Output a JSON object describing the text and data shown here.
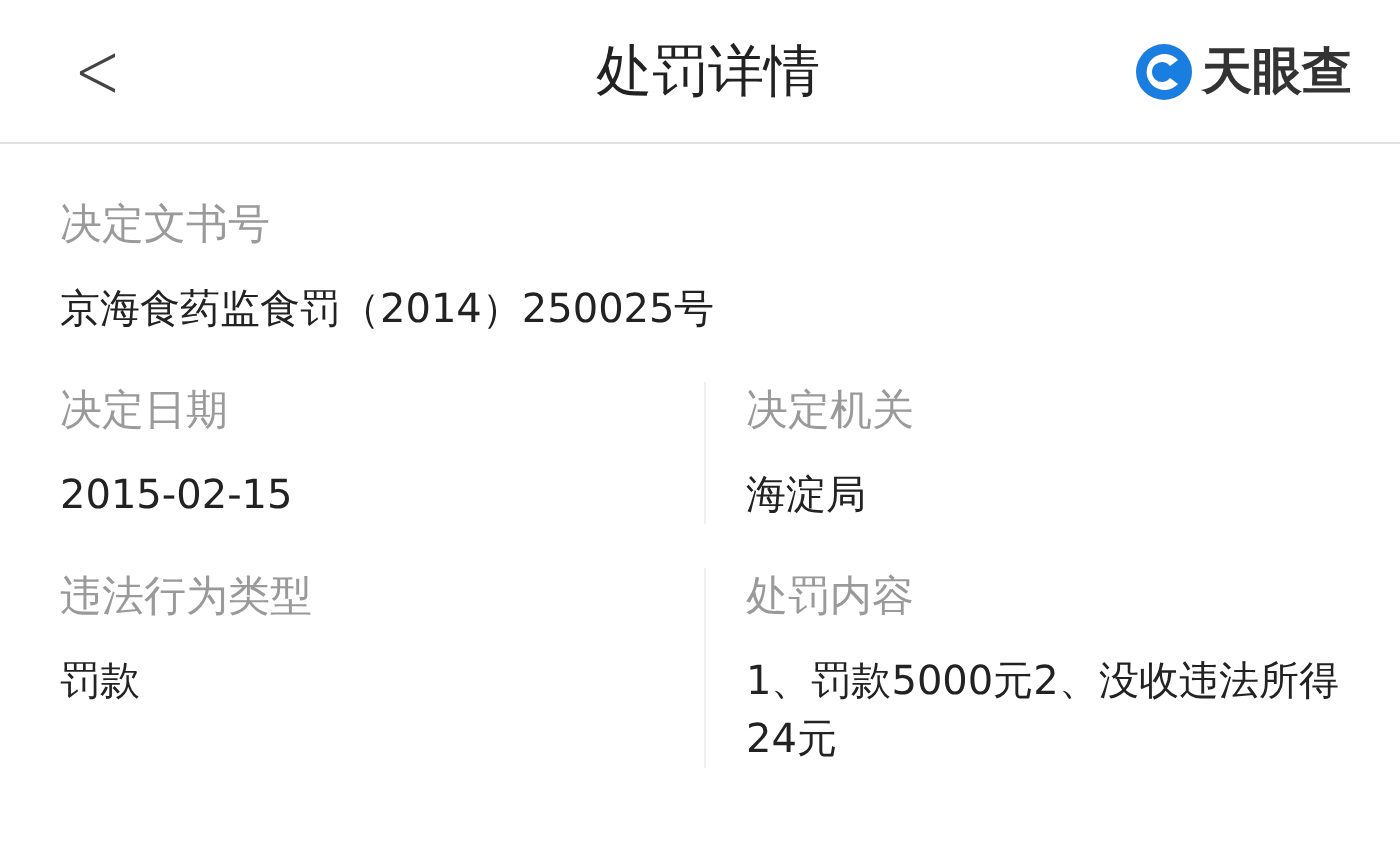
{
  "header": {
    "back": "<",
    "title": "处罚详情",
    "brand": "天眼查"
  },
  "fields": [
    {
      "label": "决定文书号",
      "value": "京海食药监食罚（2014）250025号",
      "kind": "wide"
    },
    {
      "label": "决定日期",
      "value": "2015-02-15",
      "kind": "half"
    },
    {
      "label": "决定机关",
      "value": "海淀局",
      "kind": "half"
    },
    {
      "label": "违法行为类型",
      "value": "罚款",
      "kind": "half"
    },
    {
      "label": "处罚内容",
      "value": "1、罚款5000元2、没收违法所得24元",
      "kind": "half"
    }
  ]
}
